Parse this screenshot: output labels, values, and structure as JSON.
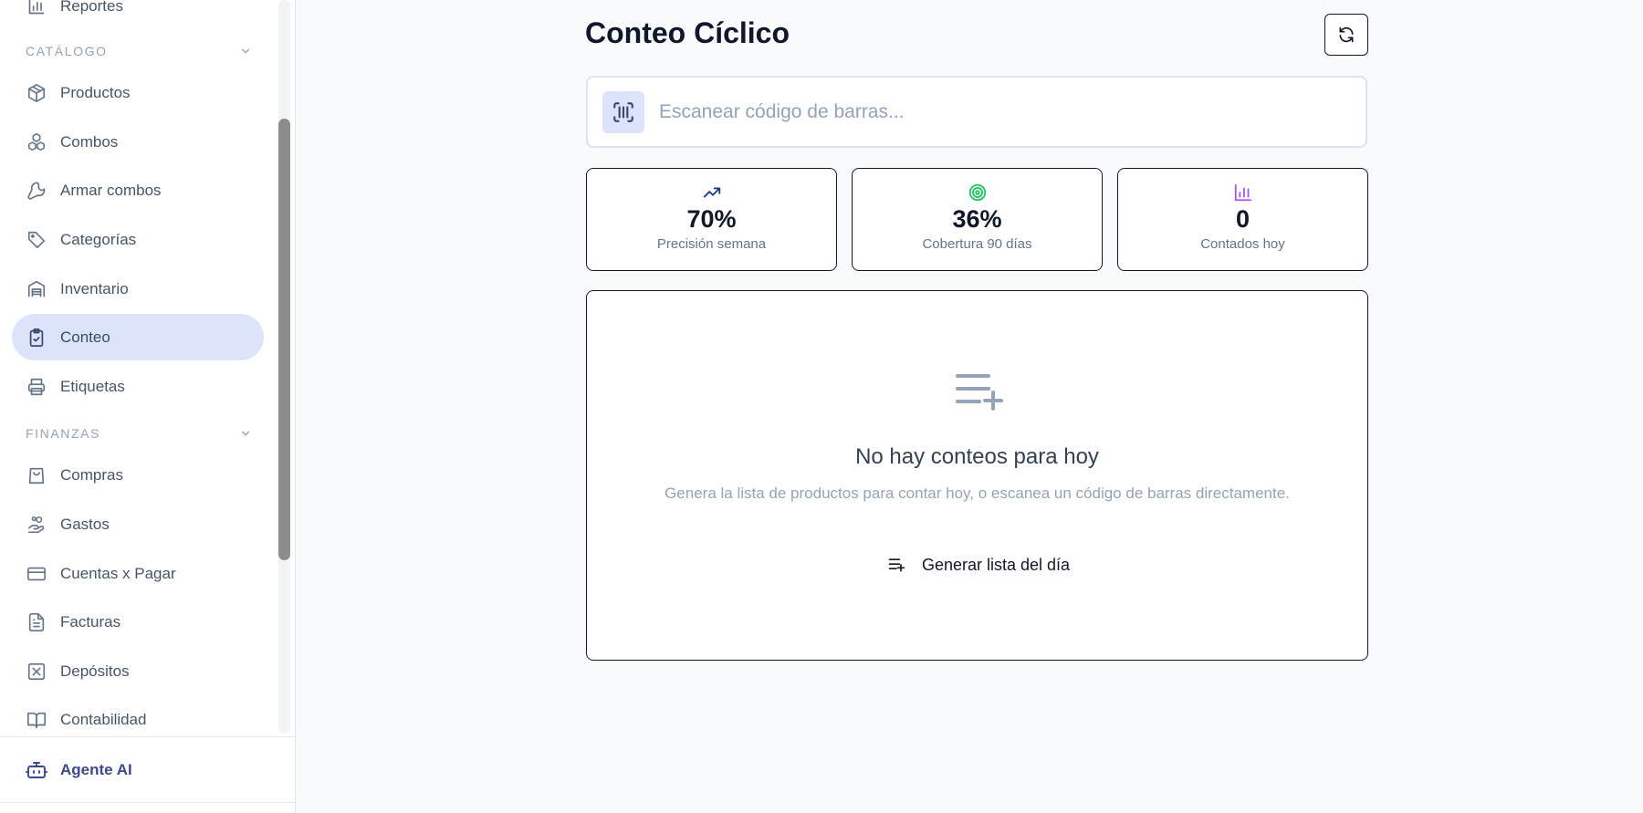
{
  "sidebar": {
    "top_item": {
      "label": "Reportes",
      "icon": "bar-chart-icon"
    },
    "sections": [
      {
        "title": "CATÁLOGO",
        "items": [
          {
            "label": "Productos",
            "icon": "package-icon"
          },
          {
            "label": "Combos",
            "icon": "boxes-icon"
          },
          {
            "label": "Armar combos",
            "icon": "wrench-icon"
          },
          {
            "label": "Categorías",
            "icon": "tag-icon"
          },
          {
            "label": "Inventario",
            "icon": "warehouse-icon"
          },
          {
            "label": "Conteo",
            "icon": "clipboard-check-icon",
            "active": true
          },
          {
            "label": "Etiquetas",
            "icon": "printer-icon"
          }
        ]
      },
      {
        "title": "FINANZAS",
        "items": [
          {
            "label": "Compras",
            "icon": "shopping-bag-icon"
          },
          {
            "label": "Gastos",
            "icon": "hand-coins-icon"
          },
          {
            "label": "Cuentas x Pagar",
            "icon": "credit-card-icon"
          },
          {
            "label": "Facturas",
            "icon": "file-text-icon"
          },
          {
            "label": "Depósitos",
            "icon": "square-x-icon"
          },
          {
            "label": "Contabilidad",
            "icon": "book-open-icon"
          }
        ]
      }
    ],
    "footer": {
      "label": "Agente AI",
      "icon": "bot-icon"
    }
  },
  "main": {
    "title": "Conteo Cíclico",
    "refresh_icon": "refresh-icon",
    "scan": {
      "placeholder": "Escanear código de barras...",
      "icon": "scan-barcode-icon"
    },
    "stats": [
      {
        "value": "70%",
        "label": "Precisión semana",
        "icon": "trending-up-icon",
        "color": "#1e3a8a"
      },
      {
        "value": "36%",
        "label": "Cobertura 90 días",
        "icon": "target-icon",
        "color": "#22c55e"
      },
      {
        "value": "0",
        "label": "Contados hoy",
        "icon": "bar-chart-icon",
        "color": "#a855f7"
      }
    ],
    "empty": {
      "icon": "list-plus-icon",
      "title": "No hay conteos para hoy",
      "description": "Genera la lista de productos para contar hoy, o escanea un código de barras directamente.",
      "button_label": "Generar lista del día"
    }
  }
}
